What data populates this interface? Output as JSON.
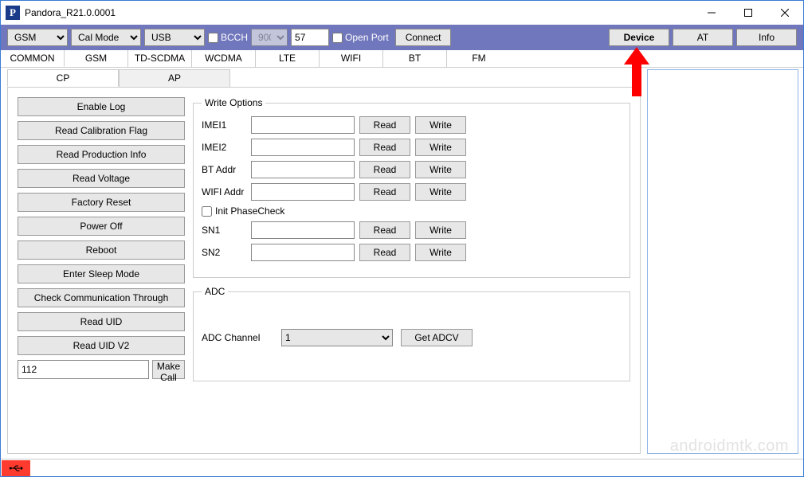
{
  "title": "Pandora_R21.0.0001",
  "toolbar": {
    "sel_gsm": "GSM",
    "sel_calmode": "Cal Mode",
    "sel_usb": "USB",
    "chk_bcch": "BCCH",
    "sel_900": "900",
    "inp_57": "57",
    "chk_openport": "Open Port",
    "btn_connect": "Connect",
    "btn_device": "Device",
    "btn_at": "AT",
    "btn_info": "Info"
  },
  "tabs1": [
    "COMMON",
    "GSM",
    "TD-SCDMA",
    "WCDMA",
    "LTE",
    "WIFI",
    "BT",
    "FM"
  ],
  "tabs2": [
    "CP",
    "AP"
  ],
  "buttons_col": [
    "Enable Log",
    "Read Calibration Flag",
    "Read Production Info",
    "Read Voltage",
    "Factory Reset",
    "Power Off",
    "Reboot",
    "Enter Sleep Mode",
    "Check Communication Through",
    "Read UID",
    "Read UID V2"
  ],
  "call": {
    "value": "112",
    "btn": "Make Call"
  },
  "write_options": {
    "legend": "Write Options",
    "rows": [
      {
        "label": "IMEI1",
        "value": ""
      },
      {
        "label": "IMEI2",
        "value": ""
      },
      {
        "label": "BT Addr",
        "value": ""
      },
      {
        "label": "WIFI Addr",
        "value": ""
      }
    ],
    "init_label": "Init PhaseCheck",
    "sn_rows": [
      {
        "label": "SN1",
        "value": ""
      },
      {
        "label": "SN2",
        "value": ""
      }
    ],
    "read": "Read",
    "write": "Write"
  },
  "adc": {
    "legend": "ADC",
    "label": "ADC Channel",
    "value": "1",
    "btn": "Get ADCV"
  },
  "watermark": "androidmtk.com"
}
